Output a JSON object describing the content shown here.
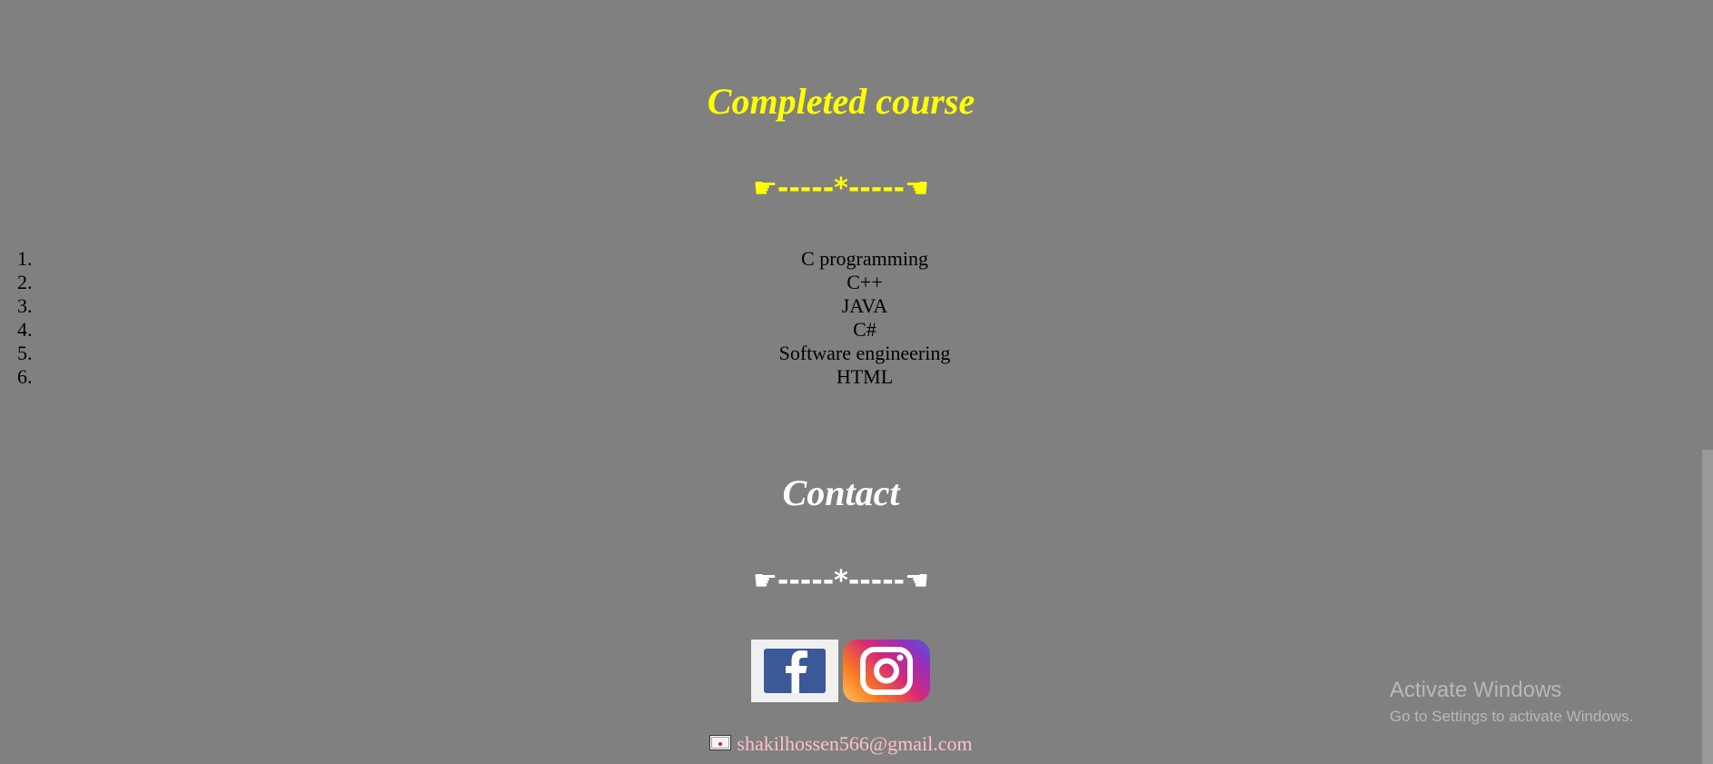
{
  "courses_section": {
    "title": "Completed course",
    "divider": "☛-----*-----☚",
    "items": [
      {
        "num": "1.",
        "label": "C programming"
      },
      {
        "num": "2.",
        "label": "C++"
      },
      {
        "num": "3.",
        "label": "JAVA"
      },
      {
        "num": "4.",
        "label": "C#"
      },
      {
        "num": "5.",
        "label": "Software engineering"
      },
      {
        "num": "6.",
        "label": "HTML"
      }
    ]
  },
  "contact_section": {
    "title": "Contact",
    "divider": "☛-----*-----☚",
    "social": [
      {
        "icon": "facebook-icon"
      },
      {
        "icon": "instagram-icon"
      }
    ],
    "email": "shakilhossen566@gmail.com"
  },
  "watermark": {
    "line1": "Activate Windows",
    "line2": "Go to Settings to activate Windows."
  },
  "colors": {
    "background": "#808080",
    "courses_heading": "#ffff00",
    "contact_heading": "#ffffff",
    "email_link": "#ffc0cb"
  }
}
